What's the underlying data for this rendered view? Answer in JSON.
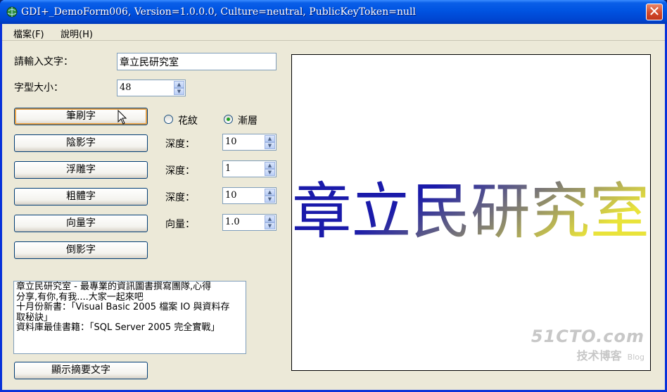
{
  "window": {
    "title": "GDI+_DemoForm006, Version=1.0.0.0, Culture=neutral, PublicKeyToken=null",
    "close_symbol": "✕"
  },
  "menu": {
    "file": "檔案(F)",
    "help": "說明(H)"
  },
  "form": {
    "input_label": "請輸入文字：",
    "input_value": "章立民研究室",
    "font_size_label": "字型大小：",
    "font_size_value": "48"
  },
  "buttons": {
    "brush": "筆刷字",
    "shadow": "陰影字",
    "emboss": "浮雕字",
    "bold": "粗體字",
    "vector": "向量字",
    "reflect": "倒影字",
    "show_summary": "顯示摘要文字"
  },
  "radios": {
    "texture": {
      "label": "花紋",
      "checked": false
    },
    "gradient": {
      "label": "漸層",
      "checked": true
    }
  },
  "params": {
    "shadow_label": "深度：",
    "shadow_value": "10",
    "emboss_label": "深度：",
    "emboss_value": "1",
    "bold_label": "深度：",
    "bold_value": "10",
    "vector_label": "向量：",
    "vector_value": "1.0"
  },
  "summary_lines": [
    "章立民研究室 - 最專業的資訊圖書撰寫團隊,心得",
    "分享,有你,有我....大家一起來吧",
    "十月份新書：「Visual Basic 2005 檔案 IO 與資料存",
    "取秘訣」",
    "資料庫最佳書籍：「SQL Server 2005 完全實戰」"
  ],
  "canvas": {
    "rendered_text": "章立民研究室",
    "gradient_colors": [
      "#1a1aaa",
      "#e9e33a"
    ]
  },
  "watermark": {
    "brand": "51CTO.com",
    "sub": "技术博客",
    "blog": "Blog"
  }
}
